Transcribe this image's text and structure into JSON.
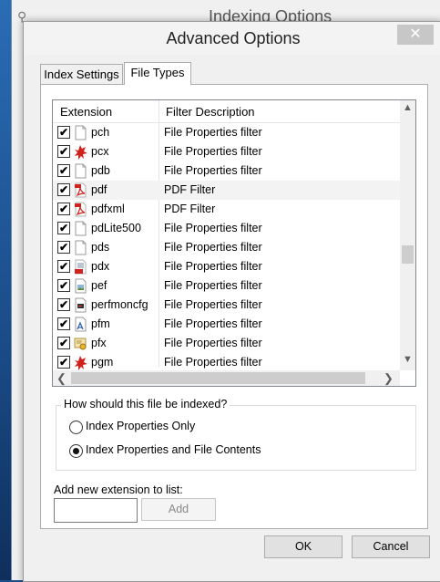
{
  "background": {
    "title": "Indexing Options"
  },
  "dialog": {
    "title": "Advanced Options",
    "close_glyph": "✕"
  },
  "tabs": [
    {
      "label": "Index Settings"
    },
    {
      "label": "File Types"
    }
  ],
  "list": {
    "columns": [
      "Extension",
      "Filter Description"
    ],
    "rows": [
      {
        "ext": "pch",
        "desc": "File Properties filter",
        "icon": "blank-file-icon",
        "checked": true
      },
      {
        "ext": "pcx",
        "desc": "File Properties filter",
        "icon": "paint-splash-icon",
        "checked": true
      },
      {
        "ext": "pdb",
        "desc": "File Properties filter",
        "icon": "blank-file-icon",
        "checked": true
      },
      {
        "ext": "pdf",
        "desc": "PDF Filter",
        "icon": "pdf-file-icon",
        "checked": true,
        "selected": true
      },
      {
        "ext": "pdfxml",
        "desc": "PDF Filter",
        "icon": "pdf-file-icon",
        "checked": true
      },
      {
        "ext": "pdLite500",
        "desc": "File Properties filter",
        "icon": "blank-file-icon",
        "checked": true
      },
      {
        "ext": "pds",
        "desc": "File Properties filter",
        "icon": "blank-file-icon",
        "checked": true
      },
      {
        "ext": "pdx",
        "desc": "File Properties filter",
        "icon": "pdf-index-file-icon",
        "checked": true
      },
      {
        "ext": "pef",
        "desc": "File Properties filter",
        "icon": "image-file-icon",
        "checked": true
      },
      {
        "ext": "perfmoncfg",
        "desc": "File Properties filter",
        "icon": "perfmon-file-icon",
        "checked": true
      },
      {
        "ext": "pfm",
        "desc": "File Properties filter",
        "icon": "font-file-icon",
        "checked": true
      },
      {
        "ext": "pfx",
        "desc": "File Properties filter",
        "icon": "certificate-file-icon",
        "checked": true
      },
      {
        "ext": "pgm",
        "desc": "File Properties filter",
        "icon": "paint-splash-icon",
        "checked": true
      }
    ],
    "check_glyph": "✔"
  },
  "index_group": {
    "legend": "How should this file be indexed?",
    "options": [
      {
        "label": "Index Properties Only",
        "selected": false
      },
      {
        "label": "Index Properties and File Contents",
        "selected": true
      }
    ]
  },
  "add_extension": {
    "label": "Add new extension to list:",
    "value": "",
    "button": "Add"
  },
  "buttons": {
    "ok": "OK",
    "cancel": "Cancel"
  },
  "colors": {
    "accent_bg": "#c7c7c7",
    "selected_row": "#f3f3f3",
    "pdf_red": "#d1231d"
  }
}
